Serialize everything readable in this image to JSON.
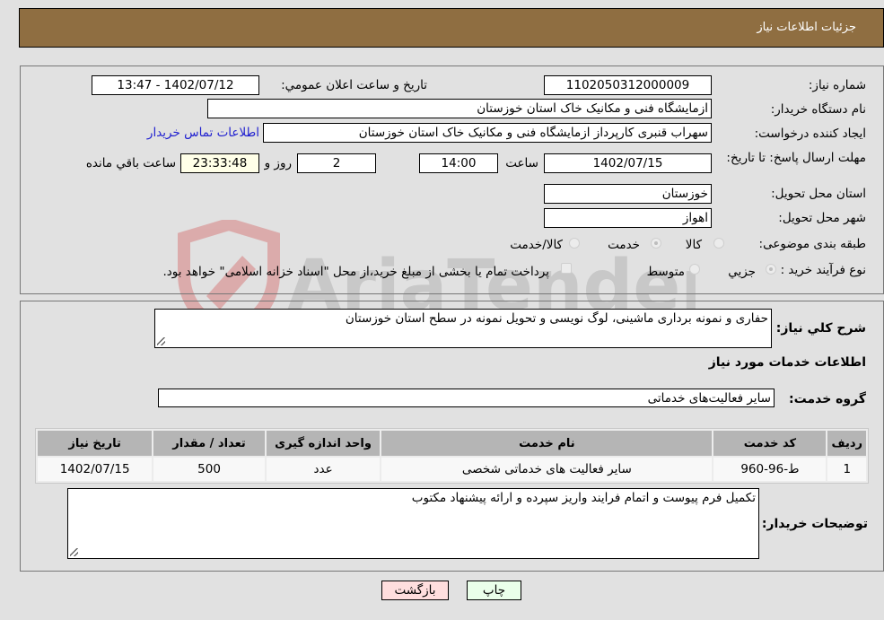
{
  "header": {
    "title": "جزئيات اطلاعات نياز"
  },
  "form": {
    "need_number_label": "شماره نياز:",
    "need_number": "1102050312000009",
    "announce_label": "تاريخ و ساعت اعلان عمومي:",
    "announce_value": "1402/07/12 - 13:47",
    "buyer_org_label": "نام دستگاه خريدار:",
    "buyer_org": "ازمایشگاه فنی و مکانیک خاک استان خوزستان",
    "creator_label": "ايجاد کننده درخواست:",
    "creator": "سهراب قنبری کارپرداز ازمایشگاه فنی و مکانیک خاک استان خوزستان",
    "buyer_contact_link": "اطلاعات تماس خريدار",
    "deadline_label": "مهلت ارسال پاسخ: تا تاريخ:",
    "deadline_date": "1402/07/15",
    "time_label": "ساعت",
    "deadline_time": "14:00",
    "days": "2",
    "days_label": "روز و",
    "remaining_time": "23:33:48",
    "remaining_label": "ساعت باقي مانده",
    "province_label": "استان محل تحويل:",
    "province": "خوزستان",
    "city_label": "شهر محل تحويل:",
    "city": "اهواز",
    "category_label": "طبقه بندی موضوعی:",
    "category_options": [
      "کالا",
      "خدمت",
      "کالا/خدمت"
    ],
    "category_selected": "خدمت",
    "process_label": "نوع فرآيند خريد :",
    "process_options": [
      "جزيي",
      "متوسط"
    ],
    "process_selected": "جزيي",
    "treasury_note": "پرداخت تمام یا بخشی از مبلغ خرید،از محل \"اسناد خزانه اسلامی\" خواهد بود."
  },
  "summary": {
    "label": "شرح کلي نياز:",
    "value": "حفاری و نمونه برداری ماشینی، لوگ نویسی و تحویل نمونه در سطح استان خوزستان",
    "services_heading": "اطلاعات خدمات مورد نياز",
    "service_group_label": "گروه خدمت:",
    "service_group": "ساير فعاليت‌هاى خدماتى"
  },
  "table": {
    "headers": [
      "رديف",
      "کد خدمت",
      "نام خدمت",
      "واحد اندازه گيری",
      "تعداد / مقدار",
      "تاريخ نياز"
    ],
    "rows": [
      [
        "1",
        "ط-96-960",
        "ساير فعاليت های خدماتی شخصی",
        "عدد",
        "500",
        "1402/07/15"
      ]
    ]
  },
  "buyer_notes": {
    "label": "توضيحات خريدار:",
    "value": "تکمیل فرم پیوست و اتمام فرایند واریز سپرده و ارائه پیشنهاد مکتوب"
  },
  "buttons": {
    "print": "چاپ",
    "back": "بازگشت"
  },
  "watermark": {
    "text": "AriaTender.neT"
  },
  "colors": {
    "header_bg": "#8f6e41",
    "print_bg": "#eaffea",
    "back_bg": "#ffdede",
    "link": "#2020d0"
  }
}
